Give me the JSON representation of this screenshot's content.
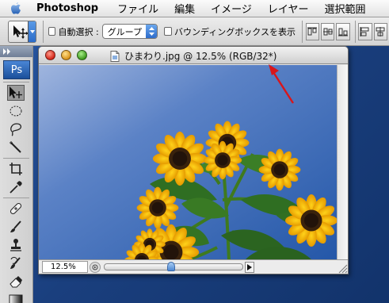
{
  "menubar": {
    "app_name": "Photoshop",
    "items": [
      "ファイル",
      "編集",
      "イメージ",
      "レイヤー",
      "選択範囲"
    ]
  },
  "options": {
    "auto_select_label": "自動選択 :",
    "auto_select_value": "グループ",
    "bounding_box_label": "バウンディングボックスを表示"
  },
  "toolbox": {
    "logo": "Ps",
    "tools": [
      "move-tool",
      "marquee-tool",
      "lasso-tool",
      "magic-wand-tool",
      "crop-tool",
      "slice-tool",
      "healing-brush-tool",
      "brush-tool",
      "clone-stamp-tool",
      "history-brush-tool",
      "eraser-tool",
      "gradient-tool"
    ]
  },
  "document": {
    "title": "ひまわり.jpg @ 12.5% (RGB/32*)",
    "zoom": "12.5%",
    "slider_position": 0.48
  },
  "colors": {
    "sky_top": "#8fa8d8",
    "sky_bottom": "#2a5ba8",
    "annotation_arrow": "#d8161b"
  }
}
